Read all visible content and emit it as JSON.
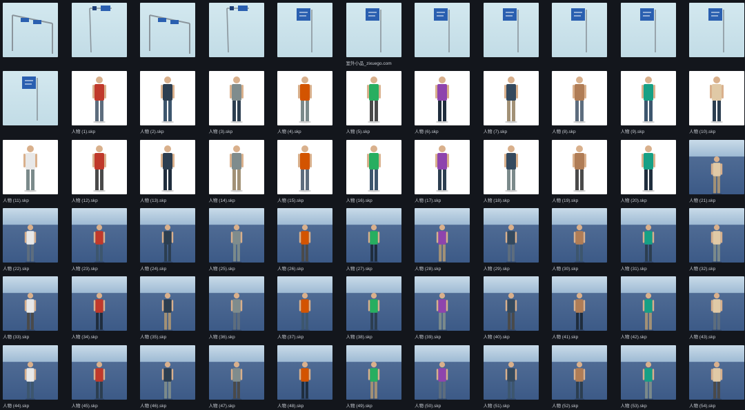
{
  "colors": {
    "background": "#13161c",
    "caption": "#c9cdd4",
    "sign": "#2a5fb0"
  },
  "tiles": [
    {
      "label": "",
      "type": "sign"
    },
    {
      "label": "",
      "type": "sign"
    },
    {
      "label": "",
      "type": "sign"
    },
    {
      "label": "",
      "type": "sign"
    },
    {
      "label": "",
      "type": "sign"
    },
    {
      "label": "室外小品_zixuego.com",
      "type": "sign"
    },
    {
      "label": "",
      "type": "sign"
    },
    {
      "label": "",
      "type": "sign"
    },
    {
      "label": "",
      "type": "sign"
    },
    {
      "label": "",
      "type": "sign"
    },
    {
      "label": "",
      "type": "sign"
    },
    {
      "label": "",
      "type": "sign"
    },
    {
      "label": "人物 (1).skp",
      "type": "white"
    },
    {
      "label": "人物 (2).skp",
      "type": "white"
    },
    {
      "label": "人物 (3).skp",
      "type": "white"
    },
    {
      "label": "人物 (4).skp",
      "type": "white"
    },
    {
      "label": "人物 (5).skp",
      "type": "white"
    },
    {
      "label": "人物 (6).skp",
      "type": "white"
    },
    {
      "label": "人物 (7).skp",
      "type": "white"
    },
    {
      "label": "人物 (8).skp",
      "type": "white"
    },
    {
      "label": "人物 (9).skp",
      "type": "white"
    },
    {
      "label": "人物 (10).skp",
      "type": "white"
    },
    {
      "label": "人物 (11).skp",
      "type": "white"
    },
    {
      "label": "人物 (12).skp",
      "type": "white"
    },
    {
      "label": "人物 (13).skp",
      "type": "white"
    },
    {
      "label": "人物 (14).skp",
      "type": "white"
    },
    {
      "label": "人物 (15).skp",
      "type": "white"
    },
    {
      "label": "人物 (16).skp",
      "type": "white"
    },
    {
      "label": "人物 (17).skp",
      "type": "white"
    },
    {
      "label": "人物 (18).skp",
      "type": "white"
    },
    {
      "label": "人物 (19).skp",
      "type": "white"
    },
    {
      "label": "人物 (20).skp",
      "type": "white"
    },
    {
      "label": "人物 (21).skp",
      "type": "scene"
    },
    {
      "label": "人物 (22).skp",
      "type": "scene"
    },
    {
      "label": "人物 (23).skp",
      "type": "scene"
    },
    {
      "label": "人物 (24).skp",
      "type": "scene"
    },
    {
      "label": "人物 (25).skp",
      "type": "scene"
    },
    {
      "label": "人物 (26).skp",
      "type": "scene"
    },
    {
      "label": "人物 (27).skp",
      "type": "scene"
    },
    {
      "label": "人物 (28).skp",
      "type": "scene"
    },
    {
      "label": "人物 (29).skp",
      "type": "scene"
    },
    {
      "label": "人物 (30).skp",
      "type": "scene"
    },
    {
      "label": "人物 (31).skp",
      "type": "scene"
    },
    {
      "label": "人物 (32).skp",
      "type": "scene"
    },
    {
      "label": "人物 (33).skp",
      "type": "scene"
    },
    {
      "label": "人物 (34).skp",
      "type": "scene"
    },
    {
      "label": "人物 (35).skp",
      "type": "scene"
    },
    {
      "label": "人物 (36).skp",
      "type": "scene"
    },
    {
      "label": "人物 (37).skp",
      "type": "scene"
    },
    {
      "label": "人物 (38).skp",
      "type": "scene"
    },
    {
      "label": "人物 (39).skp",
      "type": "scene"
    },
    {
      "label": "人物 (40).skp",
      "type": "scene"
    },
    {
      "label": "人物 (41).skp",
      "type": "scene"
    },
    {
      "label": "人物 (42).skp",
      "type": "scene"
    },
    {
      "label": "人物 (43).skp",
      "type": "scene"
    },
    {
      "label": "人物 (44).skp",
      "type": "scene"
    },
    {
      "label": "人物 (45).skp",
      "type": "scene"
    },
    {
      "label": "人物 (46).skp",
      "type": "scene"
    },
    {
      "label": "人物 (47).skp",
      "type": "scene"
    },
    {
      "label": "人物 (48).skp",
      "type": "scene"
    },
    {
      "label": "人物 (49).skp",
      "type": "scene"
    },
    {
      "label": "人物 (50).skp",
      "type": "scene"
    },
    {
      "label": "人物 (51).skp",
      "type": "scene"
    },
    {
      "label": "人物 (52).skp",
      "type": "scene"
    },
    {
      "label": "人物 (53).skp",
      "type": "scene"
    },
    {
      "label": "人物 (54).skp",
      "type": "scene"
    }
  ]
}
